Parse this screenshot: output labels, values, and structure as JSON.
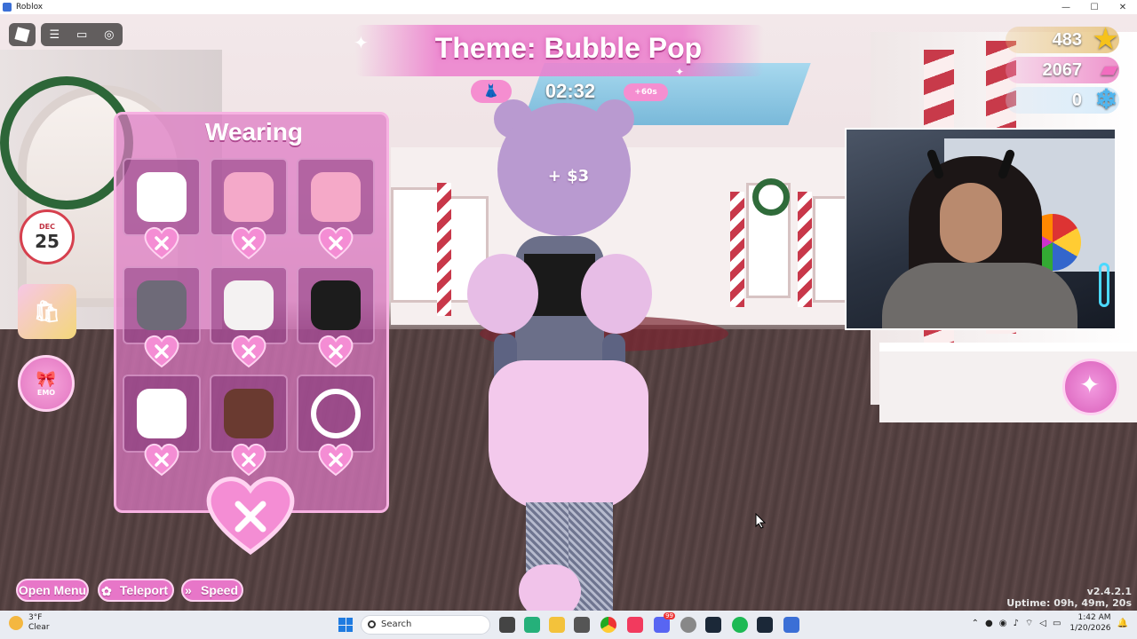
{
  "window": {
    "title": "Roblox",
    "controls": [
      "—",
      "☐",
      "✕"
    ]
  },
  "header": {
    "theme_title": "Theme: Bubble Pop",
    "timer": "02:32",
    "timer_bonus": "+60s",
    "money_popup": "+ $3"
  },
  "currency": {
    "stars": "483",
    "cash": "2067",
    "snowflakes": "0"
  },
  "sidebar": {
    "calendar_month": "DEC",
    "calendar_day": "25",
    "emotes_label": "EMO"
  },
  "wearing": {
    "title": "Wearing",
    "items": [
      {
        "icon": "white-puff-sleeves-icon",
        "color": "#ffffff"
      },
      {
        "icon": "pink-puff-sleeves-icon",
        "color": "#f4a9c9"
      },
      {
        "icon": "pink-shorts-icon",
        "color": "#f5a9c8"
      },
      {
        "icon": "grey-stockings-icon",
        "color": "#6e6a78"
      },
      {
        "icon": "white-leg-warmers-icon",
        "color": "#f4f2f2"
      },
      {
        "icon": "black-boots-icon",
        "color": "#1c1c1c"
      },
      {
        "icon": "white-skirt-icon",
        "color": "#ffffff"
      },
      {
        "icon": "brown-skirt-icon",
        "color": "#6a3a30"
      },
      {
        "icon": "white-bow-headband-icon",
        "color": "#ffffff"
      }
    ]
  },
  "bottom_menu": {
    "open_menu": "Open Menu",
    "teleport": "Teleport",
    "speed": "Speed"
  },
  "version": {
    "number": "v2.4.2.1",
    "uptime": "Uptime: 09h, 49m, 20s"
  },
  "taskbar": {
    "weather_temp": "3°F",
    "weather_desc": "Clear",
    "search_placeholder": "Search",
    "time": "1:42 AM",
    "date": "1/20/2026",
    "discord_badge": "99"
  },
  "colors": {
    "panel_pink": "#de78c4",
    "accent_pink": "#e776c8",
    "heart_pink": "#f48dd4"
  }
}
